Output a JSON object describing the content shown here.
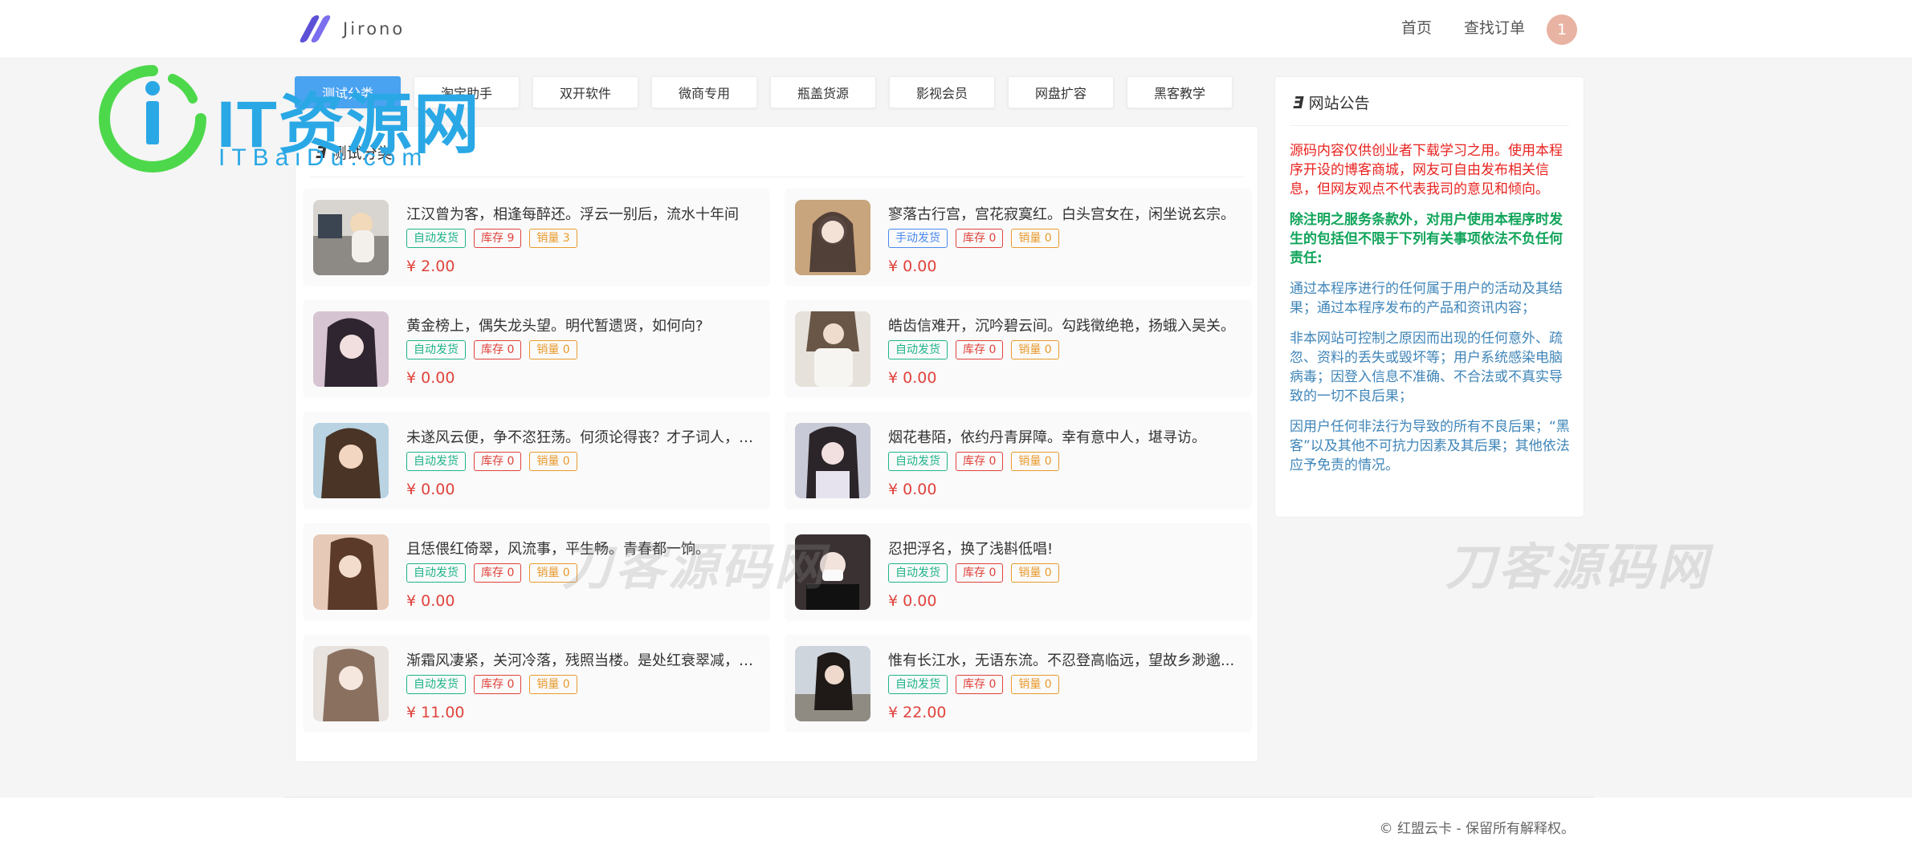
{
  "header": {
    "brand": "Jirono",
    "nav": [
      "首页",
      "查找订单"
    ],
    "avatar_text": "1"
  },
  "tabs": [
    {
      "label": "测试分类",
      "active": true
    },
    {
      "label": "淘宝助手",
      "active": false
    },
    {
      "label": "双开软件",
      "active": false
    },
    {
      "label": "微商专用",
      "active": false
    },
    {
      "label": "瓶盖货源",
      "active": false
    },
    {
      "label": "影视会员",
      "active": false
    },
    {
      "label": "网盘扩容",
      "active": false
    },
    {
      "label": "黑客教学",
      "active": false
    }
  ],
  "section": {
    "icon": "Ǝ",
    "title": "测试分类"
  },
  "products": [
    {
      "title": "江汉曾为客，相逢每醉还。浮云一别后，流水十年间",
      "delivery": "自动发货",
      "stock": "库存 9",
      "sales": "销量 3",
      "price": "¥ 2.00"
    },
    {
      "title": "寥落古行宫，宫花寂寞红。白头宫女在，闲坐说玄宗。",
      "delivery": "手动发货",
      "stock": "库存 0",
      "sales": "销量 0",
      "price": "¥ 0.00"
    },
    {
      "title": "黄金榜上，偶失龙头望。明代暂遗贤，如何向?",
      "delivery": "自动发货",
      "stock": "库存 0",
      "sales": "销量 0",
      "price": "¥ 0.00"
    },
    {
      "title": "皓齿信难开，沉吟碧云间。勾践徵绝艳，扬蛾入吴关。",
      "delivery": "自动发货",
      "stock": "库存 0",
      "sales": "销量 0",
      "price": "¥ 0.00"
    },
    {
      "title": "未遂风云便，争不恣狂荡。何须论得丧？才子词人，自...",
      "delivery": "自动发货",
      "stock": "库存 0",
      "sales": "销量 0",
      "price": "¥ 0.00"
    },
    {
      "title": "烟花巷陌，依约丹青屏障。幸有意中人，堪寻访。",
      "delivery": "自动发货",
      "stock": "库存 0",
      "sales": "销量 0",
      "price": "¥ 0.00"
    },
    {
      "title": "且恁偎红倚翠，风流事，平生畅。青春都一饷。",
      "delivery": "自动发货",
      "stock": "库存 0",
      "sales": "销量 0",
      "price": "¥ 0.00"
    },
    {
      "title": "忍把浮名，换了浅斟低唱!",
      "delivery": "自动发货",
      "stock": "库存 0",
      "sales": "销量 0",
      "price": "¥ 0.00"
    },
    {
      "title": "渐霜风凄紧，关河冷落，残照当楼。是处红衰翠减，苒...",
      "delivery": "自动发货",
      "stock": "库存 0",
      "sales": "销量 0",
      "price": "¥ 11.00"
    },
    {
      "title": "惟有长江水，无语东流。不忍登高临远，望故乡渺邈...",
      "delivery": "自动发货",
      "stock": "库存 0",
      "sales": "销量 0",
      "price": "¥ 22.00"
    }
  ],
  "notice": {
    "icon": "Ǝ",
    "title": "网站公告",
    "p1": "源码内容仅供创业者下载学习之用。使用本程序开设的博客商城，网友可自由发布相关信息，但网友观点不代表我司的意见和倾向。",
    "p2": "除注明之服务条款外，对用户使用本程序时发生的包括但不限于下列有关事项依法不负任何责任:",
    "p3": "通过本程序进行的任何属于用户的活动及其结果；通过本程序发布的产品和资讯内容；",
    "p4": "非本网站可控制之原因而出现的任何意外、疏忽、资料的丢失或毁坏等；用户系统感染电脑病毒；因登入信息不准确、不合法或不真实导致的一切不良后果；",
    "p5": "因用户任何非法行为导致的所有不良后果；“黑客”以及其他不可抗力因素及其后果；其他依法应予免责的情况。"
  },
  "footer": {
    "copyright": "© 红盟云卡 - 保留所有解释权。"
  },
  "watermarks": {
    "it_title": "IT资源网",
    "it_sub": "ITBaiDu.com",
    "daoke": "刀客源码网"
  },
  "colors": {
    "accent": "#4aa3f0",
    "price": "#e0433b",
    "green": "#20b48a",
    "brand": "#5b50d6"
  }
}
